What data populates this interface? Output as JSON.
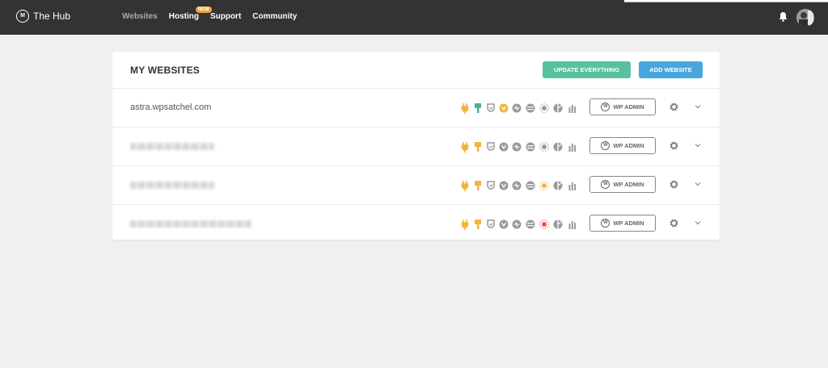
{
  "header": {
    "brand": "The Hub",
    "logo_glyph": "M",
    "nav": [
      {
        "label": "Websites",
        "active": true
      },
      {
        "label": "Hosting",
        "badge": "NEW"
      },
      {
        "label": "Support"
      },
      {
        "label": "Community"
      }
    ],
    "icons": [
      "bell-icon",
      "avatar"
    ]
  },
  "card": {
    "title": "MY WEBSITES",
    "update_label": "UPDATE EVERYTHING",
    "add_label": "ADD WEBSITE"
  },
  "sites": [
    {
      "name": "astra.wpsatchel.com",
      "blurred": false,
      "wp_admin": "WP ADMIN",
      "icon_colors": [
        "#f2b43b",
        "#4eb39a",
        "#999999",
        "#f2b43b",
        "#999999",
        "#999999",
        "#999999",
        "#999999",
        "#999999"
      ]
    },
    {
      "name": "",
      "blurred": true,
      "wp_admin": "WP ADMIN",
      "icon_colors": [
        "#f2b43b",
        "#f2b43b",
        "#999999",
        "#999999",
        "#999999",
        "#999999",
        "#999999",
        "#999999",
        "#999999"
      ]
    },
    {
      "name": "",
      "blurred": true,
      "wp_admin": "WP ADMIN",
      "icon_colors": [
        "#f2b43b",
        "#f2b43b",
        "#999999",
        "#999999",
        "#999999",
        "#999999",
        "#f2b43b",
        "#999999",
        "#999999"
      ]
    },
    {
      "name": "",
      "blurred": true,
      "wp_admin": "WP ADMIN",
      "icon_colors": [
        "#f2b43b",
        "#f2b43b",
        "#999999",
        "#999999",
        "#999999",
        "#999999",
        "#e05a4f",
        "#999999",
        "#999999"
      ]
    }
  ],
  "site_icons": [
    "plugins-icon",
    "themes-icon",
    "defender-icon",
    "smush-icon",
    "hummingbird-icon",
    "snapshot-icon",
    "uptime-icon",
    "seo-icon",
    "analytics-icon"
  ],
  "colors": {
    "topbar": "#333333",
    "update": "#58c19f",
    "add": "#47a6dd",
    "badge": "#f2a23b"
  }
}
